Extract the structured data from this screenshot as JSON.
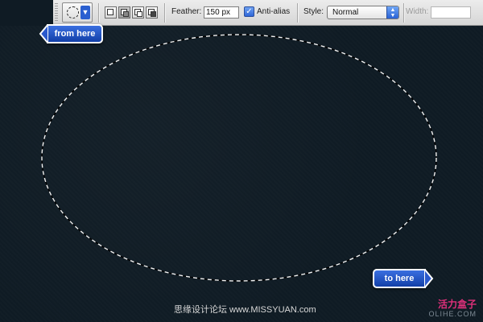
{
  "toolbar": {
    "feather_label": "Feather:",
    "feather_value": "150 px",
    "antialias_label": "Anti-alias",
    "antialias_checked": true,
    "style_label": "Style:",
    "style_value": "Normal",
    "width_label": "Width:",
    "width_value": "",
    "tool_icon": "elliptical-marquee-icon"
  },
  "callouts": {
    "from_label": "from here",
    "to_label": "to here"
  },
  "watermark": {
    "left_text": "思缘设计论坛 www.MISSYUAN.com",
    "brand": "活力盒子",
    "site": "OLIHE.COM"
  },
  "colors": {
    "canvas": "#0f1b24",
    "callout_blue": "#1e4fc2",
    "selection": "#ffffff",
    "brand_pink": "#e0307a"
  }
}
